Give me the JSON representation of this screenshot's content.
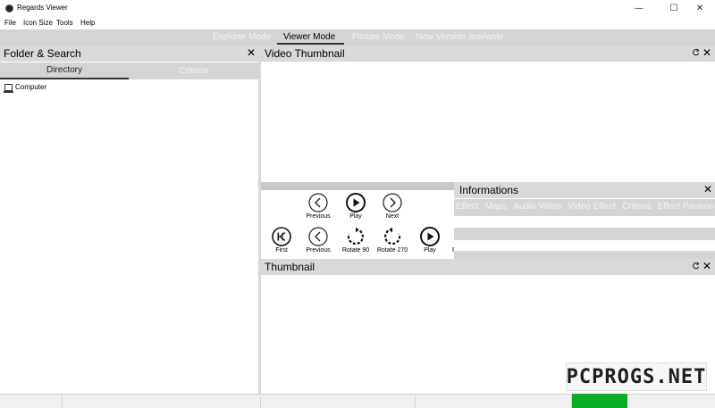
{
  "window": {
    "title": "Regards Viewer",
    "minimize": "—",
    "maximize": "☐",
    "close": "✕"
  },
  "menu": [
    "File",
    "Icon Size",
    "Tools",
    "Help"
  ],
  "modes": [
    "Explorer Mode",
    "Viewer Mode",
    "Picture Mode",
    "New Version available"
  ],
  "active_mode": "Viewer Mode",
  "folder_panel": {
    "title": "Folder & Search",
    "tabs": [
      "Directory",
      "Criteria"
    ],
    "active_tab": "Directory",
    "tree": [
      "Computer"
    ],
    "close": "✕"
  },
  "video_panel": {
    "title": "Video Thumbnail",
    "close": "✕"
  },
  "controls": {
    "row1": [
      {
        "label": "Previous",
        "icon": "chevron-left-circle-icon"
      },
      {
        "label": "Play",
        "icon": "play-circle-icon"
      },
      {
        "label": "Next",
        "icon": "chevron-right-circle-icon"
      }
    ],
    "row2": [
      {
        "label": "First",
        "icon": "skip-first-circle-icon"
      },
      {
        "label": "Previous",
        "icon": "chevron-left-circle-icon"
      },
      {
        "label": "Rotate 90",
        "icon": "rotate-cw-icon"
      },
      {
        "label": "Rotate 270",
        "icon": "rotate-ccw-icon"
      },
      {
        "label": "Play",
        "icon": "play-circle-icon"
      },
      {
        "label": "F"
      }
    ]
  },
  "info_panel": {
    "title": "Informations",
    "tabs": [
      "Effect",
      "Maps",
      "Audio Video",
      "Video Effect",
      "Criteria",
      "Effect Parame"
    ],
    "close": "✕"
  },
  "thumbnail_panel": {
    "title": "Thumbnail",
    "close": "✕"
  },
  "status": {
    "progress_fraction": 1.0,
    "progress_color": "#06b025"
  },
  "watermark": "PCPROGS.NET",
  "colors": {
    "header_gray": "#d9d9d9",
    "tab_gray": "#d4d4d4",
    "inactive_text": "#f2f2f2"
  }
}
